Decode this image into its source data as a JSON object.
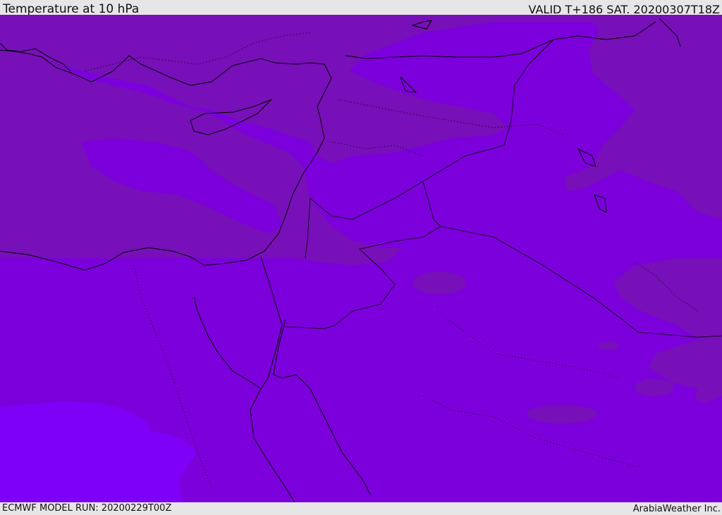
{
  "header": {
    "title": "Temperature at 10 hPa",
    "valid": "VALID T+186 SAT. 20200307T18Z"
  },
  "footer": {
    "model_run": "ECMWF MODEL RUN: 20200229T00Z",
    "credit": "ArabiaWeather Inc."
  },
  "map": {
    "colors": {
      "band_dark": "#7710b8",
      "band_mid": "#7c00db",
      "band_light": "#7f00f6",
      "coast": "#000000"
    }
  }
}
